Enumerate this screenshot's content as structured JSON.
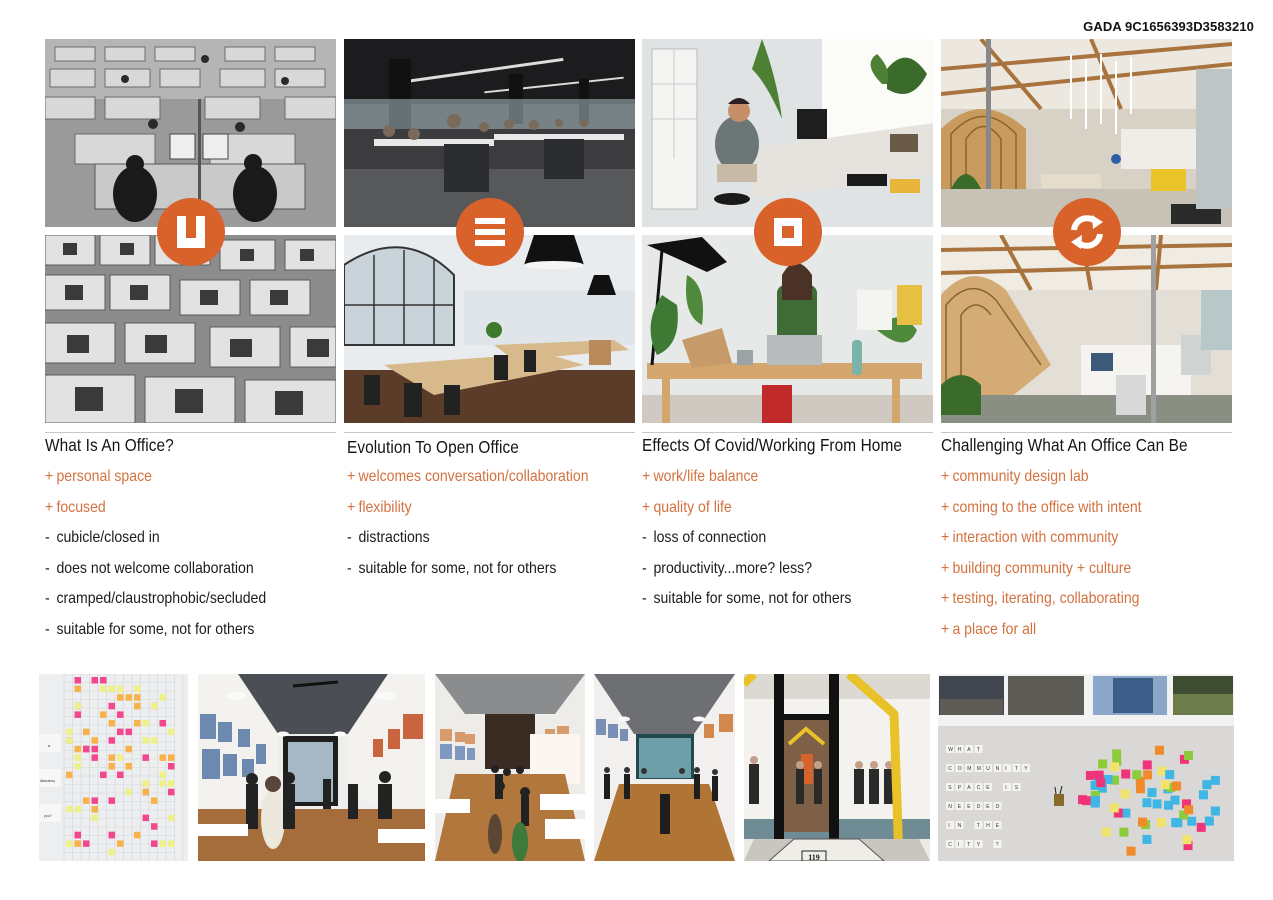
{
  "sheet_id": "GADA 9C1656393D3583210",
  "colors": {
    "accent": "#d9622b",
    "pro_text": "#d4713e",
    "con_text": "#1c1c1c",
    "rule": "#c8c8c8"
  },
  "columns": [
    {
      "title": "What Is An Office?",
      "icon": "cubicle-u-icon",
      "photos": [
        "black-and-white cubicle office with workers",
        "black-and-white rows of cubicles with CRT monitors"
      ],
      "items": [
        {
          "mark": "+",
          "text": "personal space",
          "type": "pro"
        },
        {
          "mark": "+",
          "text": "focused",
          "type": "pro"
        },
        {
          "mark": "-",
          "text": "cubicle/closed in",
          "type": "con"
        },
        {
          "mark": "-",
          "text": "does not welcome collaboration",
          "type": "con"
        },
        {
          "mark": "-",
          "text": "cramped/claustrophobic/secluded",
          "type": "con"
        },
        {
          "mark": "-",
          "text": "suitable for some, not for others",
          "type": "con"
        }
      ]
    },
    {
      "title": "Evolution To Open Office",
      "icon": "open-rows-icon",
      "photos": [
        "large open office with long rows of desks",
        "bright open office with wood desks and pendant lamps"
      ],
      "items": [
        {
          "mark": "+",
          "text": "welcomes conversation/collaboration",
          "type": "pro"
        },
        {
          "mark": "+",
          "text": "flexibility",
          "type": "pro"
        },
        {
          "mark": "-",
          "text": "distractions",
          "type": "con"
        },
        {
          "mark": "-",
          "text": "suitable for some, not for others",
          "type": "con"
        }
      ]
    },
    {
      "title": "Effects Of Covid/Working From Home",
      "icon": "home-square-icon",
      "photos": [
        "man working at home desk by window with plants",
        "woman on laptop at home desk with cat"
      ],
      "items": [
        {
          "mark": "+",
          "text": "work/life balance",
          "type": "pro"
        },
        {
          "mark": "+",
          "text": "quality of life",
          "type": "pro"
        },
        {
          "mark": "-",
          "text": "loss of connection",
          "type": "con"
        },
        {
          "mark": "-",
          "text": "productivity...more? less?",
          "type": "con"
        },
        {
          "mark": "-",
          "text": "suitable for some, not for others",
          "type": "con"
        }
      ]
    },
    {
      "title": "Challenging What An Office Can Be",
      "icon": "refresh-cycle-icon",
      "photos": [
        "warehouse office with wooden arched pod",
        "open studio with wooden tunnel structure and desks"
      ],
      "items": [
        {
          "mark": "+",
          "text": "community design lab",
          "type": "pro"
        },
        {
          "mark": "+",
          "text": "coming to the office with intent",
          "type": "pro"
        },
        {
          "mark": "+",
          "text": "interaction with community",
          "type": "pro"
        },
        {
          "mark": "+",
          "text": "building community + culture",
          "type": "pro"
        },
        {
          "mark": "+",
          "text": "testing, iterating, collaborating",
          "type": "pro"
        },
        {
          "mark": "+",
          "text": "a place for all",
          "type": "pro"
        }
      ]
    }
  ],
  "bottom_strip": {
    "photos": [
      {
        "name": "sticky-note-wall",
        "labels": [
          "a",
          "laboratory",
          "you?"
        ]
      },
      {
        "name": "gallery-event-interior"
      },
      {
        "name": "gallery-overhead-view"
      },
      {
        "name": "gallery-long-hall"
      },
      {
        "name": "storefront-entrance",
        "address": "119"
      },
      {
        "name": "community-question-board",
        "question_lines": [
          "WHAT",
          "COMMUNITY",
          "SPACE IS",
          "NEEDED",
          "IN THE",
          "CITY ?"
        ]
      }
    ]
  }
}
